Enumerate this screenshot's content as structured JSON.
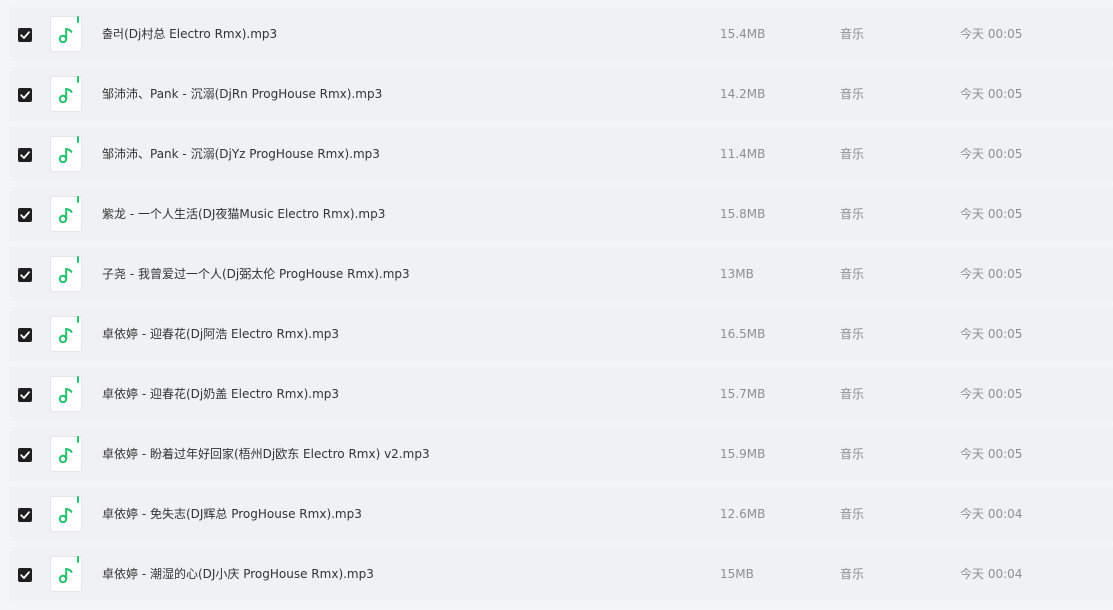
{
  "files": [
    {
      "name": "출러(Dj村总 Electro Rmx).mp3",
      "size": "15.4MB",
      "type": "音乐",
      "time": "今天 00:05",
      "checked": true
    },
    {
      "name": "邹沛沛、Pank - 沉溺(DjRn ProgHouse Rmx).mp3",
      "size": "14.2MB",
      "type": "音乐",
      "time": "今天 00:05",
      "checked": true
    },
    {
      "name": "邹沛沛、Pank - 沉溺(DjYz ProgHouse Rmx).mp3",
      "size": "11.4MB",
      "type": "音乐",
      "time": "今天 00:05",
      "checked": true
    },
    {
      "name": "紫龙 - 一个人生活(DJ夜猫Music Electro Rmx).mp3",
      "size": "15.8MB",
      "type": "音乐",
      "time": "今天 00:05",
      "checked": true
    },
    {
      "name": "子尧 - 我曾爱过一个人(Dj弼太伦 ProgHouse Rmx).mp3",
      "size": "13MB",
      "type": "音乐",
      "time": "今天 00:05",
      "checked": true
    },
    {
      "name": "卓依婷 - 迎春花(Dj阿浩 Electro Rmx).mp3",
      "size": "16.5MB",
      "type": "音乐",
      "time": "今天 00:05",
      "checked": true
    },
    {
      "name": "卓依婷 - 迎春花(Dj奶盖 Electro Rmx).mp3",
      "size": "15.7MB",
      "type": "音乐",
      "time": "今天 00:05",
      "checked": true
    },
    {
      "name": "卓依婷 - 盼着过年好回家(梧州Dj欧东 Electro Rmx) v2.mp3",
      "size": "15.9MB",
      "type": "音乐",
      "time": "今天 00:05",
      "checked": true
    },
    {
      "name": "卓依婷 - 免失志(DJ辉总 ProgHouse Rmx).mp3",
      "size": "12.6MB",
      "type": "音乐",
      "time": "今天 00:04",
      "checked": true
    },
    {
      "name": "卓依婷 - 潮湿的心(DJ小庆 ProgHouse Rmx).mp3",
      "size": "15MB",
      "type": "音乐",
      "time": "今天 00:04",
      "checked": true
    }
  ],
  "icons": {
    "checkbox": "checkbox-checked-icon",
    "file": "music-file-icon"
  },
  "colors": {
    "accent": "#25c26e",
    "checkbox": "#1f1f1f",
    "text_primary": "#333333",
    "text_secondary": "#8c8f94"
  }
}
